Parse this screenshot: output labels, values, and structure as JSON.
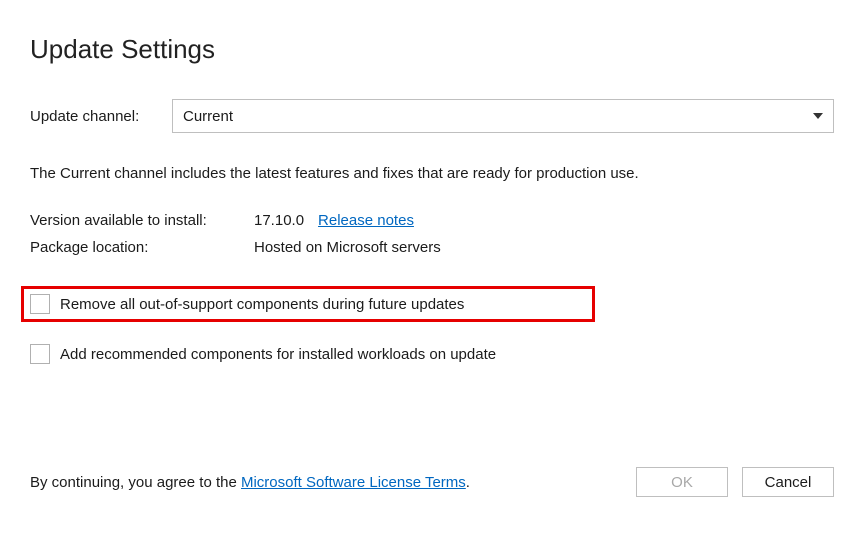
{
  "title": "Update Settings",
  "channel": {
    "label": "Update channel:",
    "selected": "Current"
  },
  "description": "The Current channel includes the latest features and fixes that are ready for production use.",
  "info": {
    "version_label": "Version available to install:",
    "version_value": "17.10.0",
    "release_notes": "Release notes",
    "package_label": "Package location:",
    "package_value": "Hosted on Microsoft servers"
  },
  "checkboxes": {
    "remove_out_of_support": "Remove all out-of-support components during future updates",
    "add_recommended": "Add recommended components for installed workloads on update"
  },
  "footer": {
    "agree_prefix": "By continuing, you agree to the ",
    "license_link": "Microsoft Software License Terms",
    "agree_suffix": ".",
    "ok": "OK",
    "cancel": "Cancel"
  }
}
